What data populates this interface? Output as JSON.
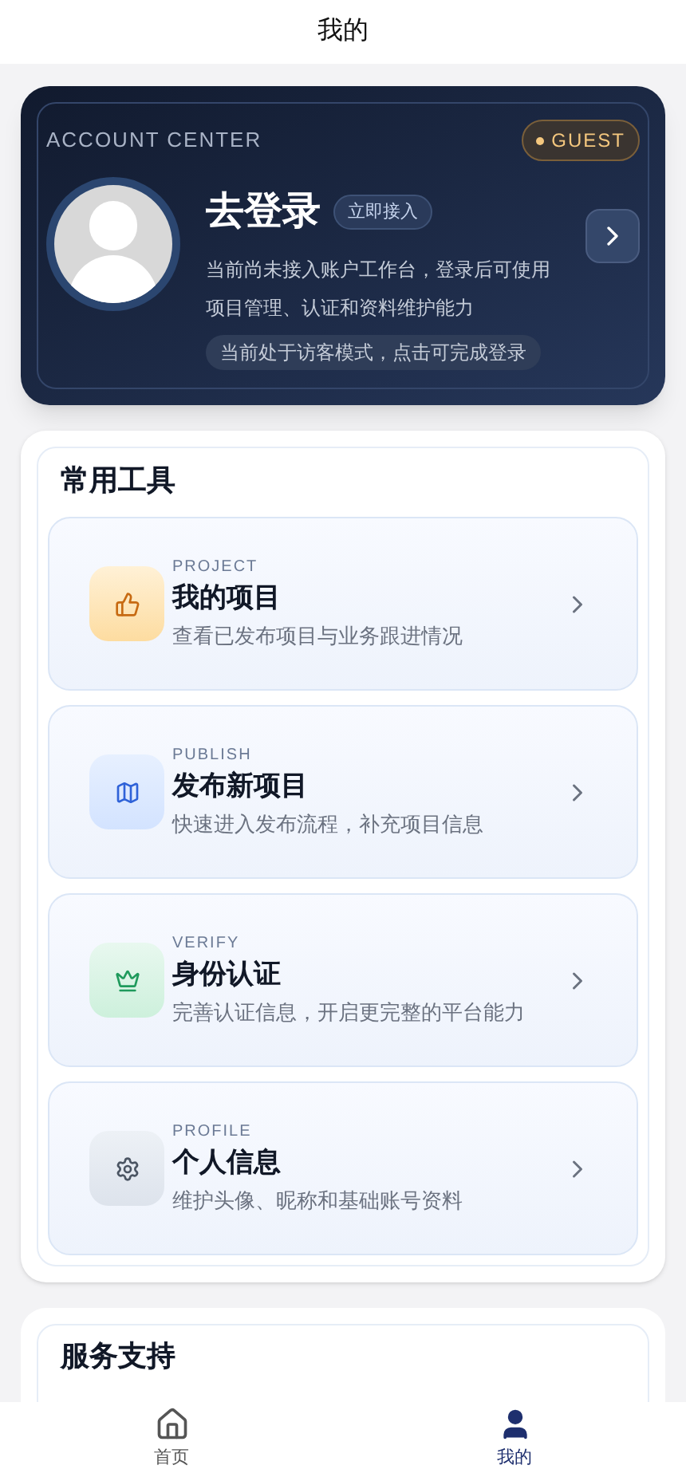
{
  "title": "我的",
  "account": {
    "eyebrow": "ACCOUNT CENTER",
    "badge": "GUEST",
    "name": "去登录",
    "tag": "立即接入",
    "description": "当前尚未接入账户工作台，登录后可使用项目管理、认证和资料维护能力",
    "hint": "当前处于访客模式，点击可完成登录"
  },
  "tools": {
    "title": "常用工具",
    "items": [
      {
        "kind": "thumb",
        "eyebrow": "PROJECT",
        "title": "我的项目",
        "description": "查看已发布项目与业务跟进情况"
      },
      {
        "kind": "map",
        "eyebrow": "PUBLISH",
        "title": "发布新项目",
        "description": "快速进入发布流程，补充项目信息"
      },
      {
        "kind": "crown",
        "eyebrow": "VERIFY",
        "title": "身份认证",
        "description": "完善认证信息，开启更完整的平台能力"
      },
      {
        "kind": "gear",
        "eyebrow": "PROFILE",
        "title": "个人信息",
        "description": "维护头像、昵称和基础账号资料"
      }
    ]
  },
  "services": {
    "title": "服务支持"
  },
  "tabs": [
    {
      "kind": "home",
      "label": "首页",
      "selected": false
    },
    {
      "kind": "user",
      "label": "我的",
      "selected": true
    }
  ]
}
